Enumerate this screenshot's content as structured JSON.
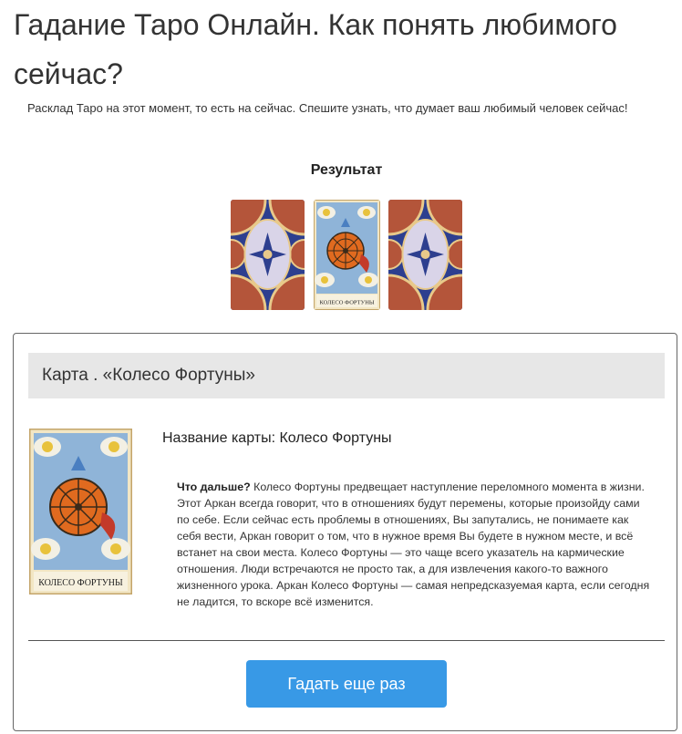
{
  "page": {
    "title": "Гадание Таро Онлайн. Как понять любимого сейчас?",
    "intro": "Расклад Таро на этот момент, то есть на сейчас. Спешите узнать, что думает ваш любимый человек сейчас!",
    "result_heading": "Результат"
  },
  "spread": {
    "cards": [
      {
        "state": "face-down",
        "icon": "tarot-card-back"
      },
      {
        "state": "face-up",
        "icon": "wheel-of-fortune-card",
        "caption": "КОЛЕСО ФОРТУНЫ"
      },
      {
        "state": "face-down",
        "icon": "tarot-card-back"
      }
    ]
  },
  "result": {
    "header": "Карта . «Колесо Фортуны»",
    "card_caption": "КОЛЕСО ФОРТУНЫ",
    "card_name": "Название карты: Колесо Фортуны",
    "description_lead": "Что дальше?",
    "description": " Колесо Фортуны предвещает наступление переломного момента в жизни. Этот Аркан всегда говорит, что в отношениях будут перемены, которые произойду сами по себе. Если сейчас есть проблемы в отношениях, Вы запутались, не понимаете как себя вести, Аркан говорит о том, что в нужное время Вы будете в нужном месте, и всё встанет на свои места. Колесо Фортуны — это чаще всего указатель на кармические отношения. Люди встречаются не просто так, а для извлечения какого-то важного жизненного урока. Аркан Колесо Фортуны — самая непредсказуемая карта, если сегодня не ладится, то вскоре всё изменится.",
    "retry_button": "Гадать еще раз"
  },
  "colors": {
    "button": "#3899e6",
    "card_back_red": "#b4553a",
    "card_back_blue": "#2d3f8f",
    "panel_header_bg": "#e7e7e7"
  }
}
